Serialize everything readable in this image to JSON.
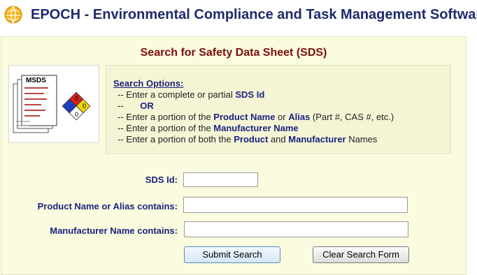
{
  "app": {
    "title": "EPOCH - Environmental Compliance and Task Management Software"
  },
  "page": {
    "title": "Search for Safety Data Sheet (SDS)"
  },
  "image": {
    "logo_text": "MSDS",
    "hazard_numbers": [
      "0",
      "0",
      "0"
    ]
  },
  "options": {
    "heading": "Search Options:",
    "lines": [
      {
        "pre": "-- Enter a complete or partial ",
        "b1": "SDS Id",
        "mid": "",
        "b2": "",
        "post": ""
      },
      {
        "pre": "-- ",
        "or": "OR"
      },
      {
        "pre": "-- Enter a portion of the ",
        "b1": "Product Name",
        "mid": " or ",
        "b2": "Alias",
        "post": " (Part #, CAS #, etc.)"
      },
      {
        "pre": "-- Enter a portion of the ",
        "b1": "Manufacturer Name",
        "mid": "",
        "b2": "",
        "post": ""
      },
      {
        "pre": "-- Enter a portion of both the ",
        "b1": "Product",
        "mid": " and ",
        "b2": "Manufacturer",
        "post": " Names"
      }
    ]
  },
  "form": {
    "sds_id_label": "SDS Id:",
    "sds_id_value": "",
    "product_label": "Product Name or Alias contains:",
    "product_value": "",
    "manufacturer_label": "Manufacturer Name contains:",
    "manufacturer_value": "",
    "submit_label": "Submit Search",
    "clear_label": "Clear Search Form"
  },
  "colors": {
    "title": "#1f2a6b",
    "page_title": "#7a0f0f",
    "panel": "#fbfbdf",
    "labels": "#1a237e"
  }
}
